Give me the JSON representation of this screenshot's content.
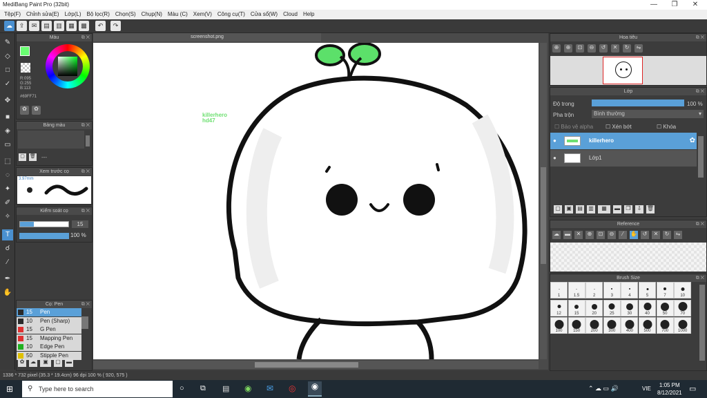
{
  "app": {
    "title": "MediBang Paint Pro (32bit)"
  },
  "window_controls": {
    "minimize": "—",
    "maximize": "❐",
    "close": "✕"
  },
  "menu": [
    "Tệp(F)",
    "Chỉnh sửa(E)",
    "Lớp(L)",
    "Bộ lọc(R)",
    "Chọn(S)",
    "Chụp(N)",
    "Màu (C)",
    "Xem(V)",
    "Công cụ(T)",
    "Cửa sổ(W)",
    "Cloud",
    "Help"
  ],
  "document": {
    "tab": "screenshot.png"
  },
  "canvas": {
    "text_line1": "killerhero",
    "text_line2": "hd47"
  },
  "color_panel": {
    "title": "Màu",
    "r": "R:095",
    "g": "G:255",
    "b": "B:113",
    "hex": "#69FF71",
    "fg": "#69ff71"
  },
  "palette_panel": {
    "title": "Bảng màu",
    "dash": "---"
  },
  "preview_panel": {
    "title": "Xem trước cọ",
    "size": "3.97mm"
  },
  "brush_control": {
    "title": "Kiểm soát cọ",
    "size": "15",
    "opacity": "100 %"
  },
  "pen_panel": {
    "title": "Cọ: Pen",
    "items": [
      {
        "n": "15",
        "label": "Pen",
        "color": "#2a2a2a"
      },
      {
        "n": "10",
        "label": "Pen (Sharp)",
        "color": "#2a2a2a"
      },
      {
        "n": "15",
        "label": "G Pen",
        "color": "#e03030"
      },
      {
        "n": "15",
        "label": "Mapping Pen",
        "color": "#e03030"
      },
      {
        "n": "10",
        "label": "Edge Pen",
        "color": "#20b020"
      },
      {
        "n": "50",
        "label": "Stipple Pen",
        "color": "#e0c000"
      }
    ]
  },
  "navigator": {
    "title": "Hoa tiêu"
  },
  "layer_panel": {
    "title": "Lớp",
    "opacity_label": "Độ trong",
    "opacity_value": "100 %",
    "blend_label": "Pha trộn",
    "blend_value": "Bình thường",
    "protect_alpha": "Bảo vệ alpha",
    "clipping": "Xén bớt",
    "lock": "Khóa",
    "layers": [
      {
        "name": "killerhero",
        "selected": true
      },
      {
        "name": "Lớp1",
        "selected": false
      }
    ]
  },
  "reference": {
    "title": "Reference"
  },
  "brush_size": {
    "title": "Brush Size",
    "row1": [
      "1",
      "1.5",
      "2",
      "3",
      "4",
      "5",
      "7",
      "10"
    ],
    "row2": [
      "12",
      "15",
      "20",
      "25",
      "30",
      "40",
      "50",
      "70"
    ],
    "row3": [
      "100",
      "150",
      "200",
      "300",
      "400",
      "500",
      "700",
      "1000"
    ]
  },
  "status": {
    "text": "1336 * 732 pixel   (35.3 * 19.4cm)   96 dpi   100 %   ( 920, 575 )"
  },
  "taskbar": {
    "search_placeholder": "Type here to search",
    "time": "1:05 PM",
    "date": "8/12/2021",
    "lang": "VIE"
  }
}
